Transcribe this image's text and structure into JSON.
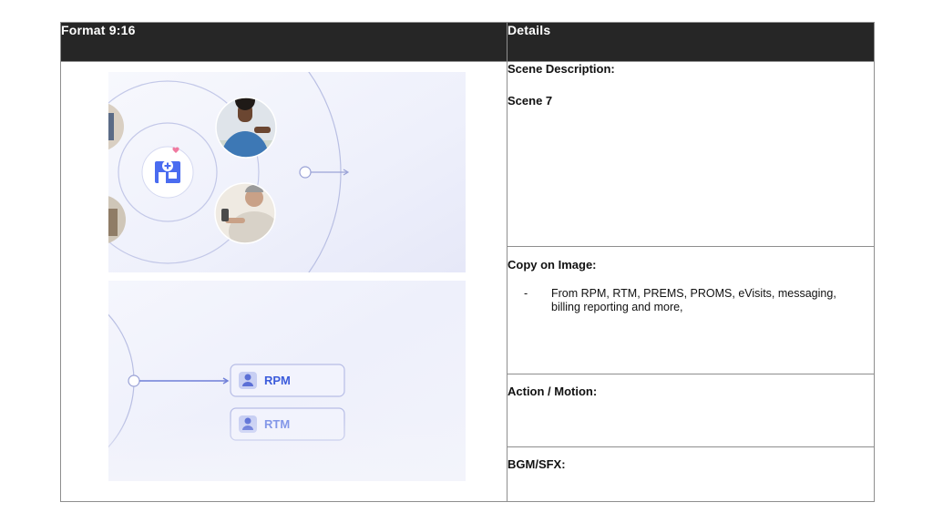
{
  "header": {
    "col1": "Format 9:16",
    "col2": "Details"
  },
  "details": {
    "scene_label": "Scene Description:",
    "scene_value": "Scene 7",
    "copy_label": "Copy on Image:",
    "copy_bullet": "-",
    "copy_text": "From RPM, RTM, PREMS, PROMS, eVisits, messaging, billing reporting and more,",
    "action_label": "Action / Motion:",
    "bgm_label": "BGM/SFX:"
  },
  "frame2": {
    "chip1": "RPM",
    "chip2": "RTM"
  },
  "colors": {
    "header_bg": "#262626",
    "accent_blue": "#3b5bdb",
    "line": "#b9bfe3"
  }
}
